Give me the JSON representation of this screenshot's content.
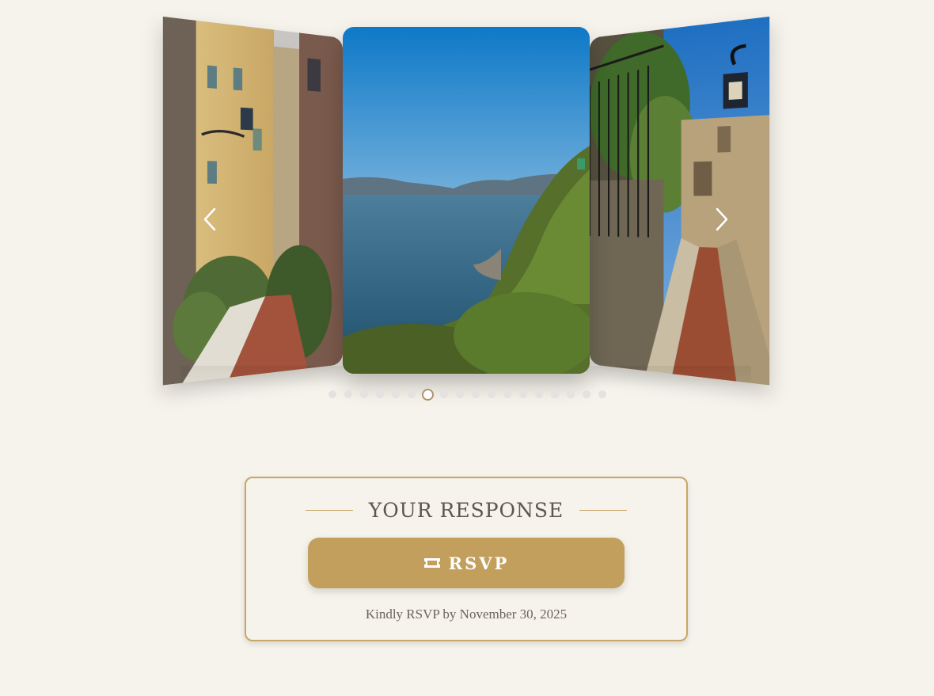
{
  "carousel": {
    "slides": [
      {
        "name": "alley-yellow-buildings"
      },
      {
        "name": "sea-coast-view"
      },
      {
        "name": "stone-lane-lantern"
      }
    ],
    "total_slides": 18,
    "active_index": 6,
    "prev_icon": "chevron-left-icon",
    "next_icon": "chevron-right-icon"
  },
  "rsvp": {
    "heading": "YOUR RESPONSE",
    "button_icon": "ticket-icon",
    "button_label": "RSVP",
    "deadline": "Kindly RSVP by November 30, 2025"
  },
  "colors": {
    "background": "#f6f3ec",
    "accent_gold": "#c29f5c",
    "border_gold": "#c8a665",
    "text_muted": "#6c645a"
  }
}
